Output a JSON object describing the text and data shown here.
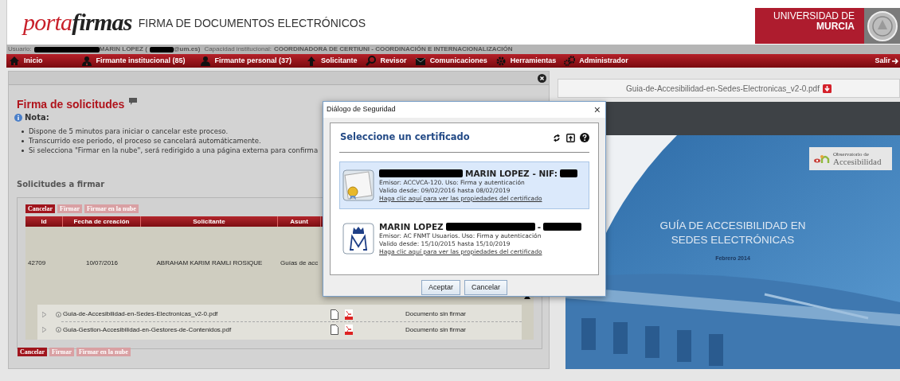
{
  "header": {
    "logo": {
      "part_1": "porta",
      "part_2": "firmas"
    },
    "title": "FIRMA DE DOCUMENTOS ELECTRÓNICOS",
    "university": {
      "line_1": "UNIVERSIDAD DE",
      "line_2": "MURCIA"
    }
  },
  "user_bar": {
    "label": "Usuario:",
    "segments": [
      {
        "kind": "redacted"
      },
      {
        "kind": "text",
        "text": "MARIN LOPEZ ("
      },
      {
        "kind": "redacted"
      },
      {
        "kind": "text",
        "text": "@um.es)"
      }
    ],
    "capacity_label": "Capacidad institucional:",
    "capacity": "COORDINADORA DE CERTIUNI - COORDINACIÓN E INTERNACIONALIZACIÓN"
  },
  "nav": {
    "items": [
      {
        "label": "Inicio"
      },
      {
        "label": "Firmante institucional (85)"
      },
      {
        "label": "Firmante personal (37)"
      },
      {
        "label": "Solicitante"
      },
      {
        "label": "Revisor"
      },
      {
        "label": "Comunicaciones"
      },
      {
        "label": "Herramientas"
      },
      {
        "label": "Administrador"
      }
    ],
    "logout": "Salir"
  },
  "main": {
    "title": "Firma de solicitudes",
    "note_label": "Nota:",
    "notes": [
      "Dispone de 5 minutos para iniciar o cancelar este proceso.",
      "Transcurrido ese periodo, el proceso se cancelará automáticamente.",
      "Si selecciona \"Firmar en la nube\", será redirigido a una página externa para confirma"
    ],
    "section_title": "Solicitudes a firmar",
    "actions": [
      {
        "label": "Cancelar",
        "disabled": false
      },
      {
        "label": "Firmar",
        "disabled": true
      },
      {
        "label": "Firmar en la nube",
        "disabled": true
      }
    ],
    "table": {
      "columns": [
        "Id",
        "Fecha de creación",
        "Solicitante",
        "Asunt"
      ],
      "rows": [
        {
          "cells": [
            "42709",
            "10/07/2016",
            "ABRAHAM KARIM RAMLI ROSIQUE",
            "Guías de acc"
          ],
          "expanded": true,
          "documents": [
            {
              "name": "Guia-de-Accesibilidad-en-Sedes-Electronicas_v2-0.pdf",
              "status": "Documento sin firmar"
            },
            {
              "name": "Guia-Gestion-Accesibilidad-en-Gestores-de-Contenidos.pdf",
              "status": "Documento sin firmar"
            }
          ]
        }
      ]
    },
    "bottom_actions": [
      {
        "label": "Cancelar",
        "disabled": false
      },
      {
        "label": "Firmar",
        "disabled": true
      },
      {
        "label": "Firmar en la nube",
        "disabled": true
      }
    ]
  },
  "viewer": {
    "filename": "Guia-de-Accesibilidad-en-Sedes-Electronicas_v2-0.pdf",
    "page": {
      "badge_line_1": "Observatorio de",
      "badge_line_2": "Accesibilidad",
      "title_line_1": "GUÍA DE ACCESIBILIDAD EN",
      "title_line_2": "SEDES ELECTRÓNICAS",
      "date": "Febrero 2014"
    }
  },
  "dialog": {
    "title": "Diálogo de Seguridad",
    "close": "×",
    "heading": "Seleccione un certificado",
    "certificates": [
      {
        "selected": true,
        "kind": "generic",
        "name": [
          {
            "kind": "redacted"
          },
          {
            "kind": "text",
            "text": "MARIN LOPEZ - NIF:"
          },
          {
            "kind": "redacted"
          }
        ],
        "issuer": "Emisor: ACCVCA-120. Uso: Firma y autenticación",
        "validity": "Valido desde: 09/02/2016 hasta 08/02/2019",
        "link": "Haga clic aquí para ver las propiedades del certificado"
      },
      {
        "selected": false,
        "kind": "fnmt",
        "name": [
          {
            "kind": "text",
            "text": "MARIN LOPEZ"
          },
          {
            "kind": "redacted"
          },
          {
            "kind": "text",
            "text": "-"
          },
          {
            "kind": "redacted"
          }
        ],
        "issuer": "Emisor: AC FNMT Usuarios. Uso: Firma y autenticación",
        "validity": "Valido desde: 15/10/2015 hasta 15/10/2019",
        "link": "Haga clic aquí para ver las propiedades del certificado"
      }
    ],
    "buttons": [
      "Aceptar",
      "Cancelar"
    ]
  }
}
